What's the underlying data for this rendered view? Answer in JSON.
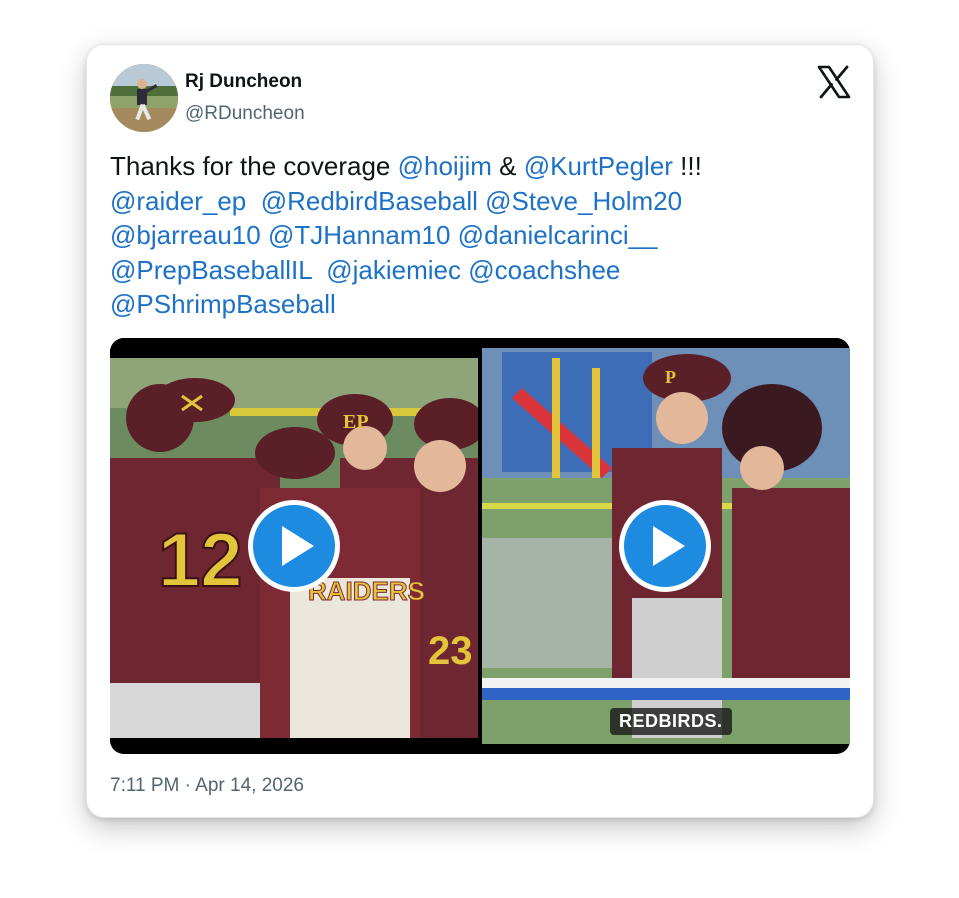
{
  "author": {
    "name": "Rj Duncheon",
    "handle": "@RDuncheon"
  },
  "brand_icon": "x-logo-icon",
  "tweet": {
    "lines": [
      [
        {
          "text": "Thanks for the coverage ",
          "mention": false
        },
        {
          "text": "@hoijim",
          "mention": true
        },
        {
          "text": " & ",
          "mention": false
        },
        {
          "text": "@KurtPegler",
          "mention": true
        },
        {
          "text": " !!!",
          "mention": false
        }
      ],
      [
        {
          "text": "@raider_ep",
          "mention": true
        },
        {
          "text": "  ",
          "mention": false
        },
        {
          "text": "@RedbirdBaseball",
          "mention": true
        },
        {
          "text": " ",
          "mention": false
        },
        {
          "text": "@Steve_Holm20",
          "mention": true
        }
      ],
      [
        {
          "text": "@bjarreau10",
          "mention": true
        },
        {
          "text": " ",
          "mention": false
        },
        {
          "text": "@TJHannam10",
          "mention": true
        },
        {
          "text": " ",
          "mention": false
        },
        {
          "text": "@danielcarinci__",
          "mention": true
        }
      ],
      [
        {
          "text": "@PrepBaseballIL",
          "mention": true
        },
        {
          "text": "  ",
          "mention": false
        },
        {
          "text": "@jakiemiec",
          "mention": true
        },
        {
          "text": " ",
          "mention": false
        },
        {
          "text": "@coachshee",
          "mention": true
        }
      ],
      [
        {
          "text": "@PShrimpBaseball",
          "mention": true
        }
      ]
    ]
  },
  "media": {
    "left_video": {
      "jersey_number": "12",
      "jersey_number_2": "23",
      "team_text": "RAIDERS",
      "cap_logo": "EP"
    },
    "right_video": {
      "caption": "REDBIRDS.",
      "cap_logo": "P"
    }
  },
  "timestamp": "7:11 PM · Apr 14, 2026",
  "colors": {
    "mention": "#1d72c8",
    "play_button": "#1d8ce0",
    "maroon": "#6e2630",
    "gold": "#e3c43a"
  }
}
